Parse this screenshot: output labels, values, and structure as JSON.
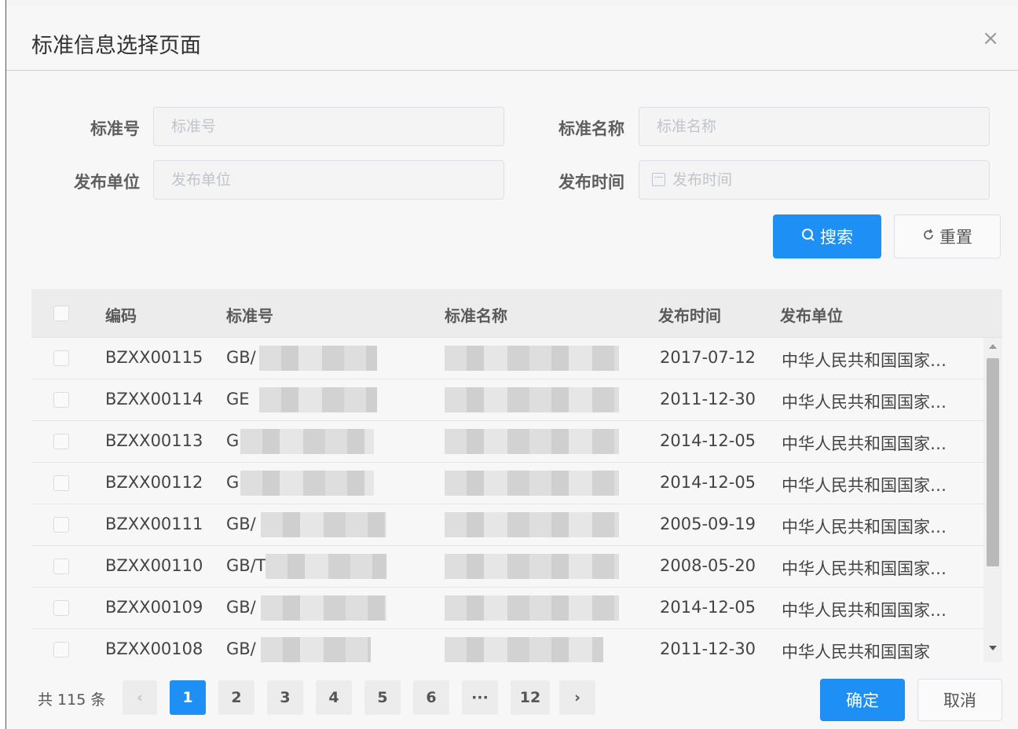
{
  "dialog": {
    "title": "标准信息选择页面",
    "close_icon": "×"
  },
  "form": {
    "standard_no": {
      "label": "标准号",
      "placeholder": "标准号"
    },
    "standard_name": {
      "label": "标准名称",
      "placeholder": "标准名称"
    },
    "publisher": {
      "label": "发布单位",
      "placeholder": "发布单位"
    },
    "publish_date": {
      "label": "发布时间",
      "placeholder": "发布时间"
    },
    "search_label": "搜索",
    "reset_label": "重置"
  },
  "table": {
    "headers": {
      "code": "编码",
      "standard_no": "标准号",
      "standard_name": "标准名称",
      "publish_date": "发布时间",
      "publisher": "发布单位"
    },
    "rows": [
      {
        "code": "BZXX00115",
        "no": "GB/",
        "date": "2017-07-12",
        "unit": "中华人民共和国国家…"
      },
      {
        "code": "BZXX00114",
        "no": "GE",
        "date": "2011-12-30",
        "unit": "中华人民共和国国家…"
      },
      {
        "code": "BZXX00113",
        "no": "G",
        "date": "2014-12-05",
        "unit": "中华人民共和国国家…"
      },
      {
        "code": "BZXX00112",
        "no": "G",
        "date": "2014-12-05",
        "unit": "中华人民共和国国家…"
      },
      {
        "code": "BZXX00111",
        "no": "GB/",
        "date": "2005-09-19",
        "unit": "中华人民共和国国家…"
      },
      {
        "code": "BZXX00110",
        "no": "GB/T",
        "date": "2008-05-20",
        "unit": "中华人民共和国国家…"
      },
      {
        "code": "BZXX00109",
        "no": "GB/",
        "date": "2014-12-05",
        "unit": "中华人民共和国国家…"
      },
      {
        "code": "BZXX00108",
        "no": "GB/",
        "date": "2011-12-30",
        "unit": "中华人民共和国国家"
      }
    ]
  },
  "pagination": {
    "total_text": "共 115 条",
    "prev_icon": "‹",
    "next_icon": "›",
    "pages": [
      "1",
      "2",
      "3",
      "4",
      "5",
      "6",
      "···",
      "12"
    ],
    "current": "1"
  },
  "footer": {
    "confirm_label": "确定",
    "cancel_label": "取消"
  },
  "colors": {
    "primary": "#1e8ff5"
  }
}
